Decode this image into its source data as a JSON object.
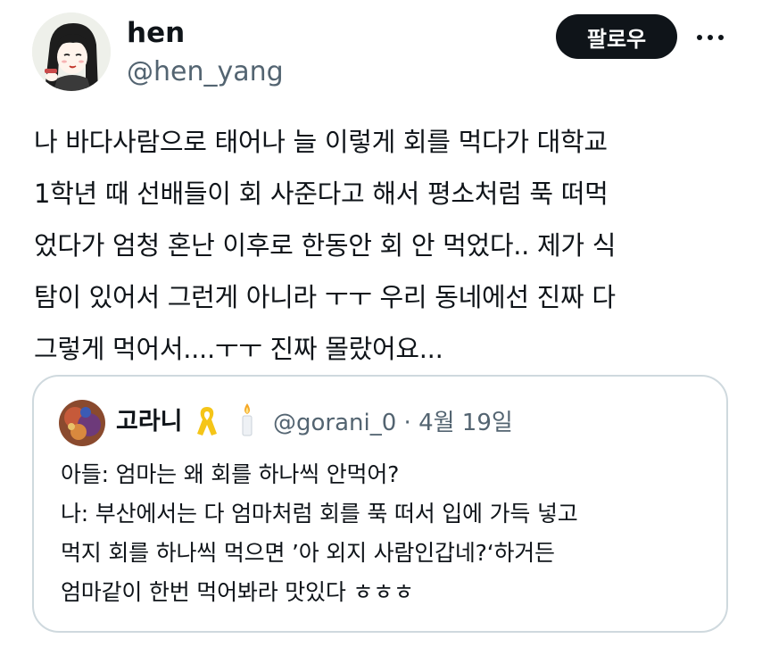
{
  "author": {
    "display_name": "hen",
    "handle": "@hen_yang"
  },
  "follow_label": "팔로우",
  "more_icon": "more-horizontal-icon",
  "tweet": {
    "lines": [
      "나 바다사람으로 태어나 늘 이렇게 회를 먹다가 대학교",
      "1학년 때 선배들이 회 사준다고 해서 평소처럼 푹 떠먹",
      "었다가 엄청 혼난 이후로 한동안 회 안 먹었다.. 제가 식",
      "탐이 있어서 그런게 아니라 ㅜㅜ 우리 동네에선 진짜 다",
      "그렇게 먹어서....ㅜㅜ 진짜 몰랐어요..."
    ]
  },
  "quote": {
    "display_name": "고라니",
    "icons": [
      "yellow-ribbon-icon",
      "candle-icon"
    ],
    "meta": "@gorani_0 · 4월 19일",
    "lines": [
      "아들: 엄마는 왜 회를 하나씩 안먹어?",
      "나: 부산에서는 다 엄마처럼 회를 푹 떠서 입에 가득 넣고",
      "먹지 회를 하나씩 먹으면 ’아 외지 사람인갑네?‘하거든",
      "엄마같이 한번 먹어봐라 맛있다 ㅎㅎㅎ"
    ]
  },
  "colors": {
    "text": "#0f1419",
    "secondary_text": "#536471",
    "follow_button_bg": "#0f1419",
    "card_border": "#cfd9de",
    "ribbon": "#f5c518"
  }
}
